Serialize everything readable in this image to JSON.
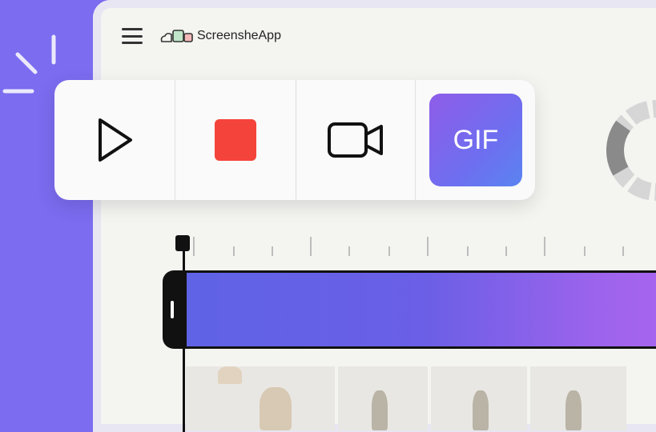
{
  "app": {
    "name": "ScreensheApp",
    "menu_icon": "hamburger-menu-icon",
    "logo_icon": "app-logo-icon"
  },
  "toolbar": {
    "items": [
      {
        "id": "play",
        "icon": "play-icon"
      },
      {
        "id": "stop",
        "icon": "stop-icon",
        "color": "#f4433b"
      },
      {
        "id": "record-video",
        "icon": "video-camera-icon"
      },
      {
        "id": "gif",
        "label": "GIF"
      }
    ]
  },
  "colors": {
    "background": "#7b6cf0",
    "track_start": "#5f63e6",
    "track_end": "#a865ee",
    "gif_start": "#8f5de8",
    "gif_end": "#5a84f0"
  }
}
